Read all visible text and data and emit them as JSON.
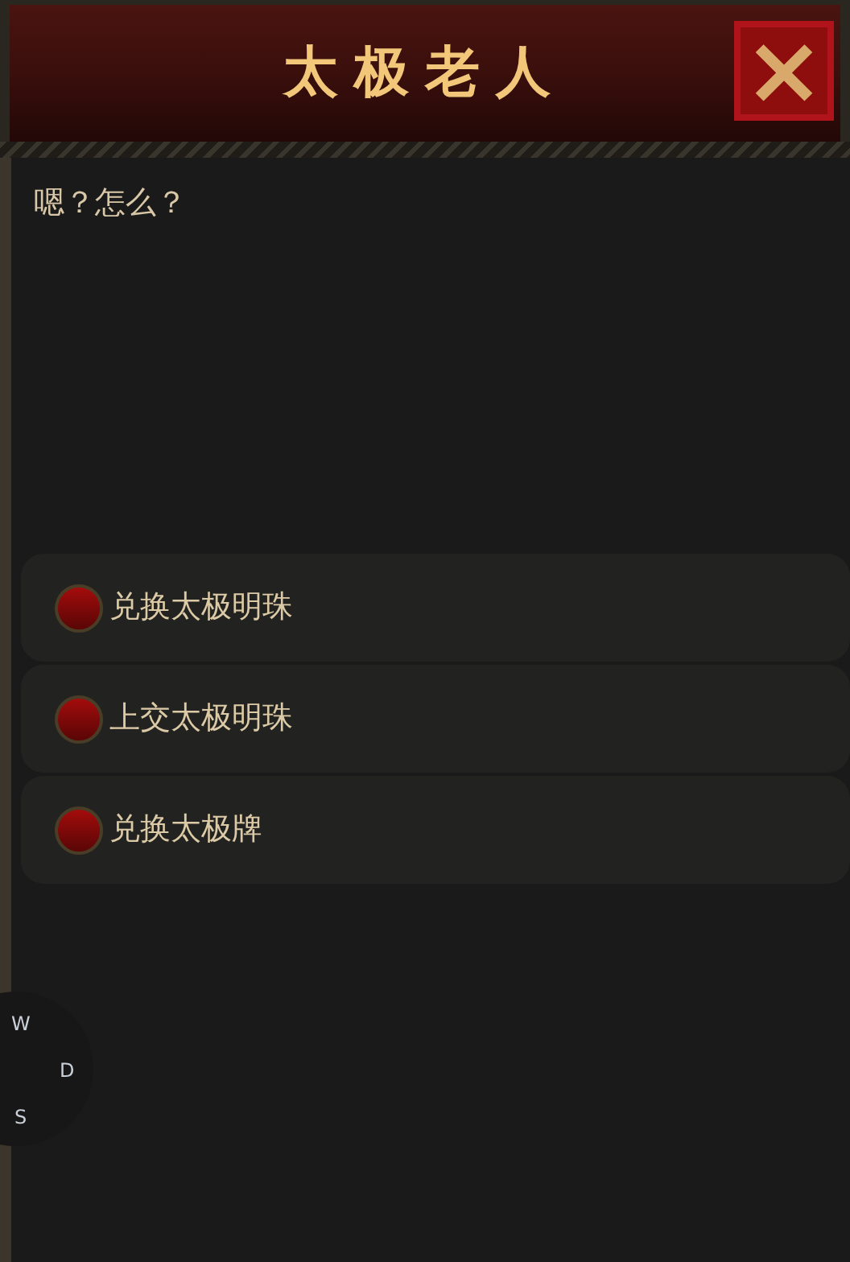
{
  "window": {
    "title": "太极老人",
    "close": "×"
  },
  "dialog": {
    "text": "嗯？怎么？"
  },
  "options": [
    {
      "label": "兑换太极明珠"
    },
    {
      "label": "上交太极明珠"
    },
    {
      "label": "兑换太极牌"
    }
  ],
  "joystick": {
    "keys": [
      "W",
      "D",
      "S"
    ]
  }
}
